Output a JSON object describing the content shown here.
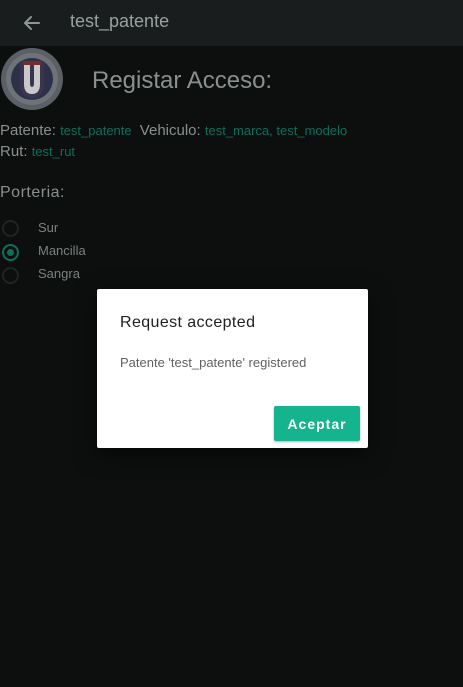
{
  "appbar": {
    "title": "test_patente",
    "back_icon": "arrow-left-icon"
  },
  "header": {
    "title": "Registar Acceso:",
    "logo_icon": "university-crest-logo"
  },
  "fields": {
    "patente_label": "Patente:",
    "patente_value": "test_patente",
    "vehiculo_label": "Vehiculo:",
    "vehiculo_value": "test_marca, test_modelo",
    "rut_label": "Rut:",
    "rut_value": "test_rut"
  },
  "porteria": {
    "label": "Porteria:",
    "options": [
      {
        "label": "Sur",
        "selected": false
      },
      {
        "label": "Mancilla",
        "selected": true
      },
      {
        "label": "Sangra",
        "selected": false
      }
    ]
  },
  "dialog": {
    "title": "Request accepted",
    "message": "Patente 'test_patente' registered",
    "button_label": "Aceptar"
  },
  "colors": {
    "accent": "#14b48f",
    "value_text": "#0c6f5c",
    "background": "#0d0f0f",
    "appbar": "#1a1d1d"
  }
}
